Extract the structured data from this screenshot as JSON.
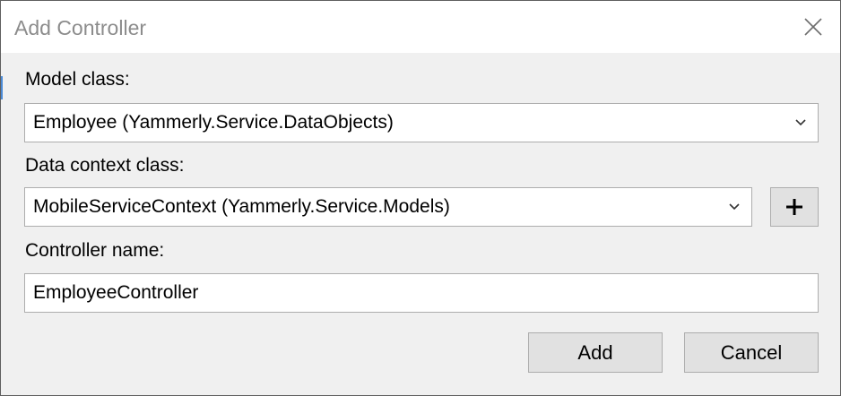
{
  "window": {
    "title": "Add Controller",
    "close_icon": "close-icon"
  },
  "model_class": {
    "label": "Model class:",
    "selected": "Employee (Yammerly.Service.DataObjects)",
    "icon": "chevron-down-icon"
  },
  "data_context_class": {
    "label": "Data context class:",
    "selected": "MobileServiceContext (Yammerly.Service.Models)",
    "icon": "chevron-down-icon",
    "add_icon": "plus-icon"
  },
  "controller_name": {
    "label": "Controller name:",
    "value": "EmployeeController"
  },
  "buttons": {
    "add": "Add",
    "cancel": "Cancel"
  },
  "colors": {
    "accent": "#4a8ad6",
    "title_text": "#8c8c8c",
    "button_face": "#e1e1e1",
    "border": "#adadad"
  }
}
